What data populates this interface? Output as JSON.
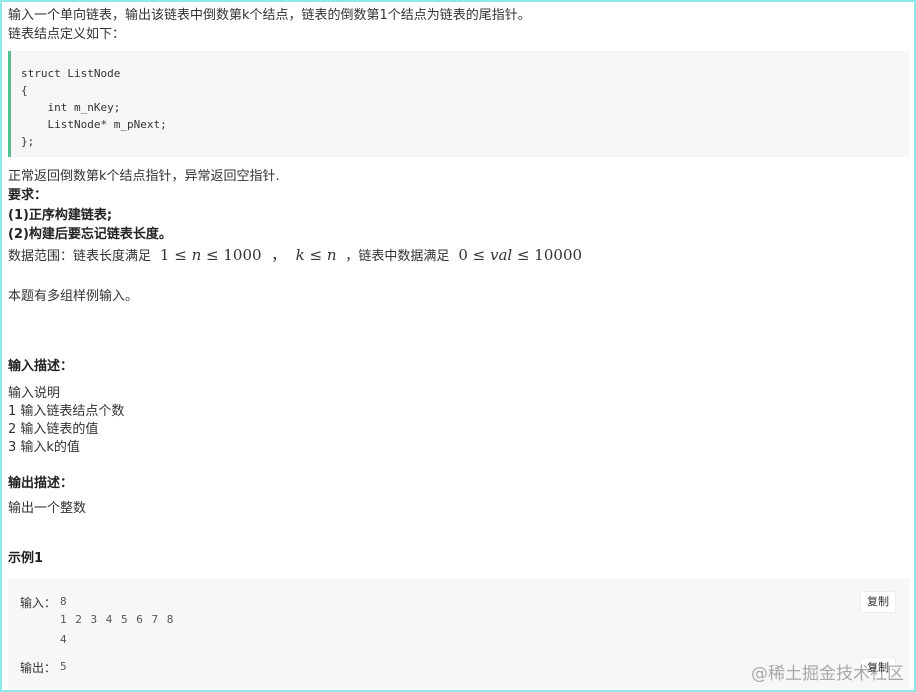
{
  "intro": {
    "line1": "输入一个单向链表，输出该链表中倒数第k个结点，链表的倒数第1个结点为链表的尾指针。",
    "line2": "链表结点定义如下："
  },
  "code": {
    "lines": [
      "struct ListNode",
      "{",
      "    int m_nKey;",
      "    ListNode* m_pNext;",
      "};"
    ]
  },
  "notes": {
    "return_line": "正常返回倒数第k个结点指针，异常返回空指针.",
    "requirements_title": "要求：",
    "req1": "(1)正序构建链表;",
    "req2": "(2)构建后要忘记链表长度。",
    "range_prefix": "数据范围：链表长度满足",
    "range_mid": "，链表中数据满足",
    "multi_case": "本题有多组样例输入。"
  },
  "input_desc": {
    "title": "输入描述：",
    "lines": [
      "输入说明",
      "1 输入链表结点个数",
      "2 输入链表的值",
      "3 输入k的值"
    ]
  },
  "output_desc": {
    "title": "输出描述：",
    "line": "输出一个整数"
  },
  "example": {
    "title": "示例1",
    "input_label": "输入：",
    "input_lines": [
      "8",
      "1 2 3 4 5 6 7 8",
      "4"
    ],
    "output_label": "输出：",
    "output_value": "5",
    "copy_label": "复制"
  },
  "watermark": "@稀土掘金技术社区"
}
